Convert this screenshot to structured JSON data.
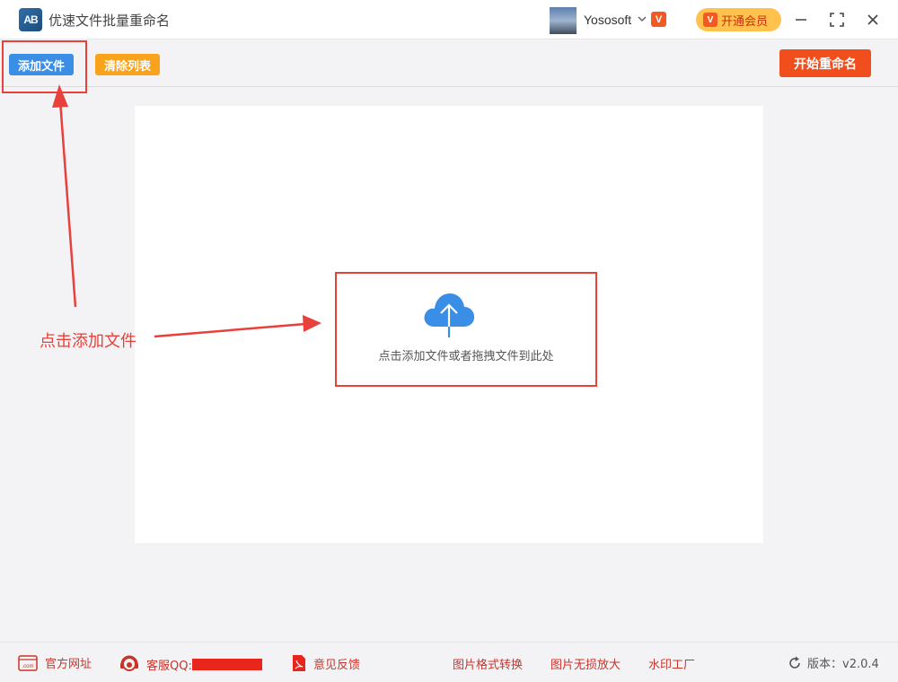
{
  "app": {
    "title": "优速文件批量重命名",
    "logo_text": "AB"
  },
  "user": {
    "name": "Yososoft",
    "badge": "V"
  },
  "header": {
    "vip_label": "开通会员",
    "vip_icon": "V"
  },
  "toolbar": {
    "add_label": "添加文件",
    "clear_label": "清除列表",
    "start_label": "开始重命名"
  },
  "dropzone": {
    "hint": "点击添加文件或者拖拽文件到此处",
    "icon": "cloud-upload-icon"
  },
  "annotation": {
    "text": "点击添加文件",
    "color": "#e8403a"
  },
  "footer": {
    "website": "官方网址",
    "website_icon_text": ".com",
    "support": "客服QQ:",
    "feedback": "意见反馈",
    "links": [
      "图片格式转换",
      "图片无损放大",
      "水印工厂"
    ],
    "version_label": "版本：v2.0.4"
  },
  "colors": {
    "primary": "#3a8ee6",
    "warning": "#f9a21b",
    "danger": "#f04e1d",
    "link": "#c8342a"
  }
}
